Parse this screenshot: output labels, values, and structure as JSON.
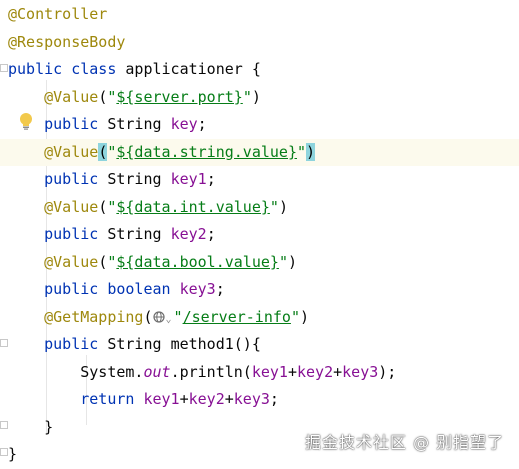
{
  "editor": {
    "lines": [
      {
        "tokens": [
          {
            "t": "@Controller",
            "c": "ann"
          }
        ]
      },
      {
        "tokens": [
          {
            "t": "@ResponseBody",
            "c": "ann"
          }
        ]
      },
      {
        "tokens": [
          {
            "t": "public class ",
            "c": "kw"
          },
          {
            "t": "applicationer {",
            "c": "plain"
          }
        ]
      },
      {
        "tokens": [
          {
            "t": "    ",
            "c": "plain"
          },
          {
            "t": "@Value",
            "c": "ann"
          },
          {
            "t": "(",
            "c": "plain"
          },
          {
            "t": "\"",
            "c": "str"
          },
          {
            "t": "${server.port}",
            "c": "placeholder"
          },
          {
            "t": "\"",
            "c": "str"
          },
          {
            "t": ")",
            "c": "plain"
          }
        ]
      },
      {
        "tokens": [
          {
            "t": "    ",
            "c": "plain"
          },
          {
            "t": "public ",
            "c": "kw"
          },
          {
            "t": "String ",
            "c": "plain"
          },
          {
            "t": "key",
            "c": "field"
          },
          {
            "t": ";",
            "c": "plain"
          }
        ]
      },
      {
        "highlight": true,
        "tokens": [
          {
            "t": "    ",
            "c": "plain"
          },
          {
            "t": "@Value",
            "c": "ann"
          },
          {
            "t": "(",
            "c": "brace-hl"
          },
          {
            "t": "\"",
            "c": "str"
          },
          {
            "t": "${data.string.value}",
            "c": "placeholder"
          },
          {
            "t": "\"",
            "c": "str"
          },
          {
            "t": ")",
            "c": "brace-hl"
          }
        ]
      },
      {
        "tokens": [
          {
            "t": "    ",
            "c": "plain"
          },
          {
            "t": "public ",
            "c": "kw"
          },
          {
            "t": "String ",
            "c": "plain"
          },
          {
            "t": "key1",
            "c": "field"
          },
          {
            "t": ";",
            "c": "plain"
          }
        ]
      },
      {
        "tokens": [
          {
            "t": "    ",
            "c": "plain"
          },
          {
            "t": "@Value",
            "c": "ann"
          },
          {
            "t": "(",
            "c": "plain"
          },
          {
            "t": "\"",
            "c": "str"
          },
          {
            "t": "${data.int.value}",
            "c": "placeholder"
          },
          {
            "t": "\"",
            "c": "str"
          },
          {
            "t": ")",
            "c": "plain"
          }
        ]
      },
      {
        "tokens": [
          {
            "t": "    ",
            "c": "plain"
          },
          {
            "t": "public ",
            "c": "kw"
          },
          {
            "t": "String ",
            "c": "plain"
          },
          {
            "t": "key2",
            "c": "field"
          },
          {
            "t": ";",
            "c": "plain"
          }
        ]
      },
      {
        "tokens": [
          {
            "t": "    ",
            "c": "plain"
          },
          {
            "t": "@Value",
            "c": "ann"
          },
          {
            "t": "(",
            "c": "plain"
          },
          {
            "t": "\"",
            "c": "str"
          },
          {
            "t": "${data.bool.value}",
            "c": "placeholder"
          },
          {
            "t": "\"",
            "c": "str"
          },
          {
            "t": ")",
            "c": "plain"
          }
        ]
      },
      {
        "tokens": [
          {
            "t": "    ",
            "c": "plain"
          },
          {
            "t": "public ",
            "c": "kw"
          },
          {
            "t": "boolean ",
            "c": "kw"
          },
          {
            "t": "key3",
            "c": "field"
          },
          {
            "t": ";",
            "c": "plain"
          }
        ]
      },
      {
        "tokens": [
          {
            "t": "    ",
            "c": "plain"
          },
          {
            "t": "@GetMapping",
            "c": "ann"
          },
          {
            "t": "(",
            "c": "plain"
          },
          {
            "t": "",
            "c": "globe"
          },
          {
            "t": "\"",
            "c": "str"
          },
          {
            "t": "/server-info",
            "c": "placeholder"
          },
          {
            "t": "\"",
            "c": "str"
          },
          {
            "t": ")",
            "c": "plain"
          }
        ]
      },
      {
        "tokens": [
          {
            "t": "    ",
            "c": "plain"
          },
          {
            "t": "public ",
            "c": "kw"
          },
          {
            "t": "String ",
            "c": "plain"
          },
          {
            "t": "method1",
            "c": "plain"
          },
          {
            "t": "(){",
            "c": "plain"
          }
        ]
      },
      {
        "tokens": [
          {
            "t": "        ",
            "c": "plain"
          },
          {
            "t": "System.",
            "c": "plain"
          },
          {
            "t": "out",
            "c": "static"
          },
          {
            "t": ".println(",
            "c": "plain"
          },
          {
            "t": "key1",
            "c": "field"
          },
          {
            "t": "+",
            "c": "plain"
          },
          {
            "t": "key2",
            "c": "field"
          },
          {
            "t": "+",
            "c": "plain"
          },
          {
            "t": "key3",
            "c": "field"
          },
          {
            "t": ");",
            "c": "plain"
          }
        ]
      },
      {
        "tokens": [
          {
            "t": "        ",
            "c": "plain"
          },
          {
            "t": "return ",
            "c": "kw"
          },
          {
            "t": "key1",
            "c": "field"
          },
          {
            "t": "+",
            "c": "plain"
          },
          {
            "t": "key2",
            "c": "field"
          },
          {
            "t": "+",
            "c": "plain"
          },
          {
            "t": "key3",
            "c": "field"
          },
          {
            "t": ";",
            "c": "plain"
          }
        ]
      },
      {
        "tokens": [
          {
            "t": "    }",
            "c": "plain"
          }
        ]
      },
      {
        "tokens": [
          {
            "t": "}",
            "c": "plain"
          }
        ]
      }
    ]
  },
  "watermark": "掘金技术社区 @ 别指望了",
  "icons": {
    "gutter_hint": "lightbulb-icon",
    "inlay": "globe-icon"
  },
  "colors": {
    "annotation": "#9e880d",
    "keyword": "#0033b3",
    "string": "#067d17",
    "field": "#871094",
    "highlight_line": "#fcfaed",
    "brace_match": "#8ed4dd"
  }
}
